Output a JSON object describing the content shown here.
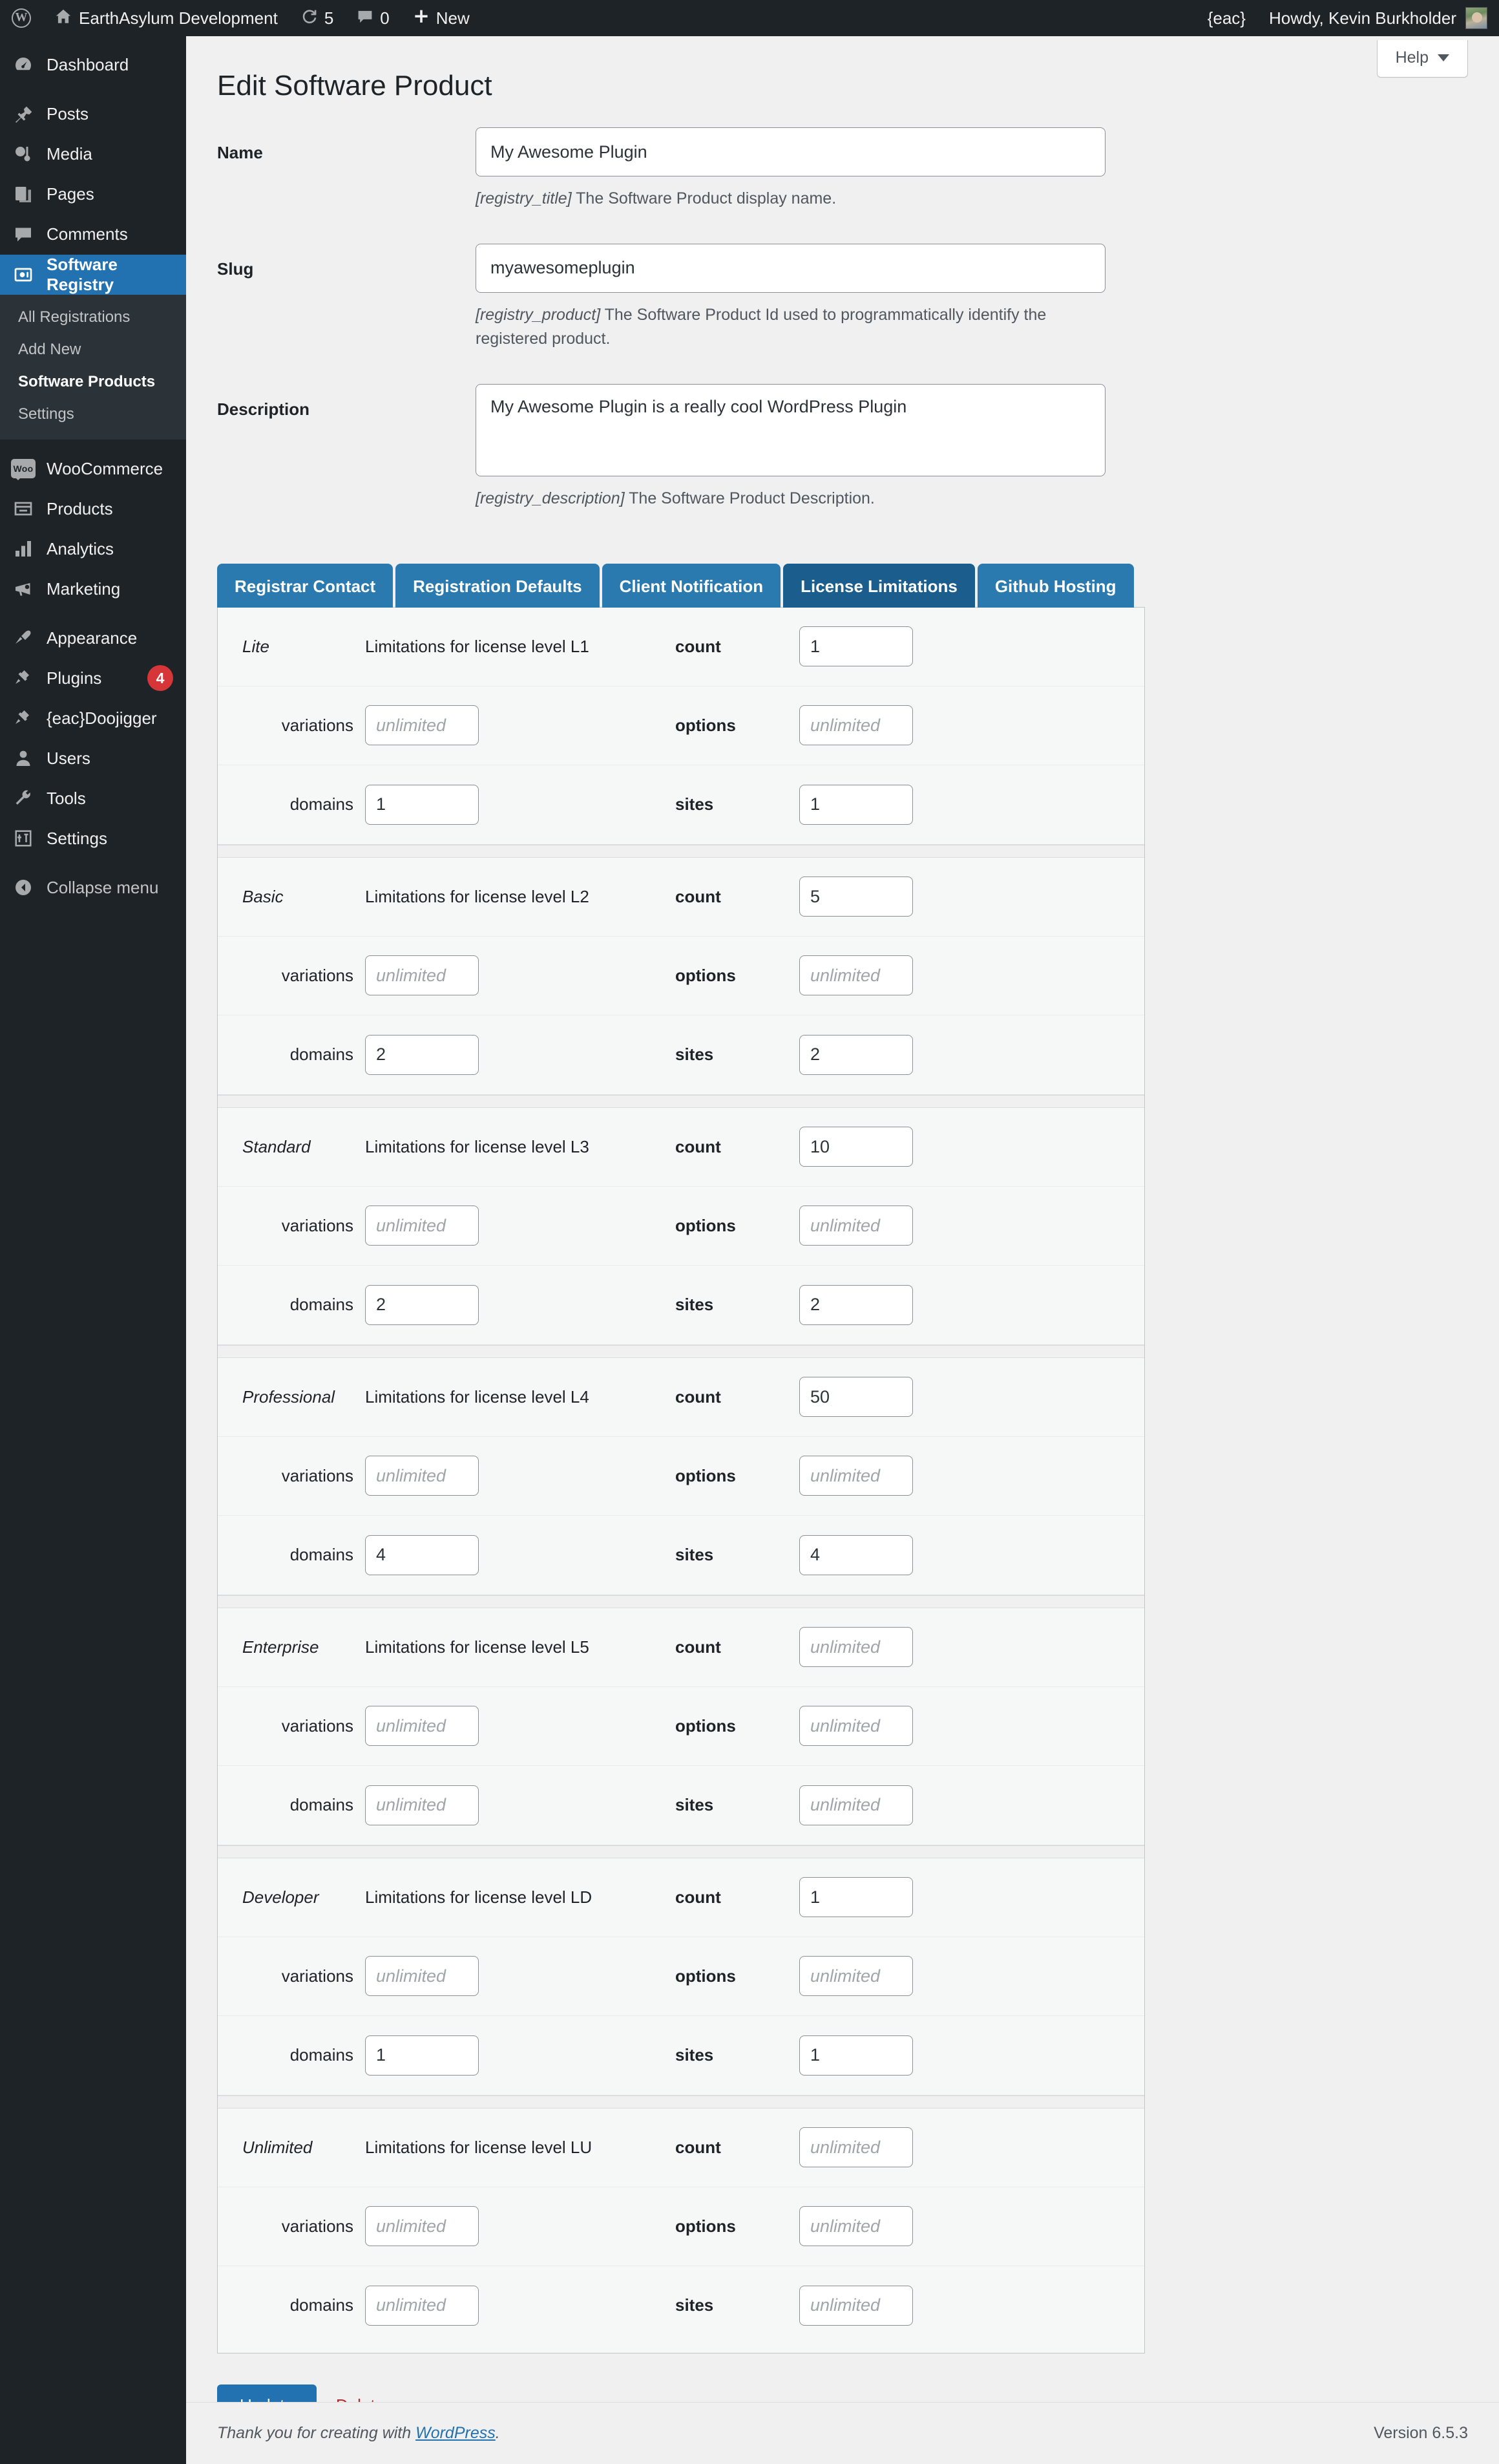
{
  "adminbar": {
    "logo_icon": "wordpress-logo-icon",
    "home_icon": "home-icon",
    "site_name": "EarthAsylum Development",
    "updates_icon": "updates-icon",
    "updates_count": "5",
    "comments_icon": "comment-bubble-icon",
    "comments_count": "0",
    "new_icon": "plus-icon",
    "new_label": "New",
    "eac_label": "{eac}",
    "howdy": "Howdy, Kevin Burkholder",
    "avatar": "user-avatar"
  },
  "sidebar": {
    "items": [
      {
        "label": "Dashboard",
        "icon": "dashboard-icon",
        "current": false
      },
      {
        "label": "Posts",
        "icon": "pin-icon",
        "current": false
      },
      {
        "label": "Media",
        "icon": "media-icon",
        "current": false
      },
      {
        "label": "Pages",
        "icon": "pages-icon",
        "current": false
      },
      {
        "label": "Comments",
        "icon": "comments-icon",
        "current": false
      },
      {
        "label": "Software Registry",
        "icon": "software-registry-icon",
        "current": true
      },
      {
        "label": "WooCommerce",
        "icon": "woocommerce-icon",
        "current": false
      },
      {
        "label": "Products",
        "icon": "products-icon",
        "current": false
      },
      {
        "label": "Analytics",
        "icon": "analytics-icon",
        "current": false
      },
      {
        "label": "Marketing",
        "icon": "marketing-megaphone-icon",
        "current": false
      },
      {
        "label": "Appearance",
        "icon": "paintbrush-icon",
        "current": false
      },
      {
        "label": "Plugins",
        "icon": "plug-icon",
        "current": false,
        "badge": "4"
      },
      {
        "label": "{eac}Doojigger",
        "icon": "plug-icon",
        "current": false
      },
      {
        "label": "Users",
        "icon": "user-icon",
        "current": false
      },
      {
        "label": "Tools",
        "icon": "wrench-icon",
        "current": false
      },
      {
        "label": "Settings",
        "icon": "settings-sliders-icon",
        "current": false
      },
      {
        "label": "Collapse menu",
        "icon": "collapse-arrow-icon",
        "current": false
      }
    ],
    "submenu": [
      {
        "label": "All Registrations",
        "current": false
      },
      {
        "label": "Add New",
        "current": false
      },
      {
        "label": "Software Products",
        "current": true
      },
      {
        "label": "Settings",
        "current": false
      }
    ]
  },
  "header": {
    "page_title": "Edit Software Product",
    "help_label": "Help",
    "help_caret_icon": "chevron-down-icon"
  },
  "form": {
    "fields": [
      {
        "label": "Name",
        "value": "My Awesome Plugin",
        "placeholder": "",
        "desc_key": "[registry_title]",
        "desc_text": " The Software Product display name.",
        "type": "text"
      },
      {
        "label": "Slug",
        "value": "myawesomeplugin",
        "placeholder": "",
        "desc_key": "[registry_product]",
        "desc_text": " The Software Product Id used to programmatically identify the registered product.",
        "type": "text"
      },
      {
        "label": "Description",
        "value": "My Awesome Plugin is a really cool WordPress Plugin",
        "placeholder": "",
        "desc_key": "[registry_description]",
        "desc_text": " The Software Product Description.",
        "type": "textarea"
      }
    ]
  },
  "tabs": [
    {
      "label": "Registrar Contact",
      "active": false
    },
    {
      "label": "Registration Defaults",
      "active": false
    },
    {
      "label": "Client Notification",
      "active": false
    },
    {
      "label": "License Limitations",
      "active": true
    },
    {
      "label": "Github Hosting",
      "active": false
    }
  ],
  "license_panel": {
    "labels": {
      "count": "count",
      "variations": "variations",
      "options": "options",
      "domains": "domains",
      "sites": "sites"
    },
    "placeholder_unlimited": "unlimited",
    "levels": [
      {
        "name": "Lite",
        "description": "Limitations for license level L1",
        "count": "1",
        "variations": "",
        "options": "",
        "domains": "1",
        "sites": "1"
      },
      {
        "name": "Basic",
        "description": "Limitations for license level L2",
        "count": "5",
        "variations": "",
        "options": "",
        "domains": "2",
        "sites": "2"
      },
      {
        "name": "Standard",
        "description": "Limitations for license level L3",
        "count": "10",
        "variations": "",
        "options": "",
        "domains": "2",
        "sites": "2"
      },
      {
        "name": "Professional",
        "description": "Limitations for license level L4",
        "count": "50",
        "variations": "",
        "options": "",
        "domains": "4",
        "sites": "4"
      },
      {
        "name": "Enterprise",
        "description": "Limitations for license level L5",
        "count": "",
        "variations": "",
        "options": "",
        "domains": "",
        "sites": ""
      },
      {
        "name": "Developer",
        "description": "Limitations for license level LD",
        "count": "1",
        "variations": "",
        "options": "",
        "domains": "1",
        "sites": "1"
      },
      {
        "name": "Unlimited",
        "description": "Limitations for license level LU",
        "count": "",
        "variations": "",
        "options": "",
        "domains": "",
        "sites": ""
      }
    ]
  },
  "actions": {
    "update_label": "Update",
    "delete_label": "Delete"
  },
  "footer": {
    "thanks_prefix": "Thank you for creating with ",
    "wordpress_link": "WordPress",
    "thanks_suffix": ".",
    "version": "Version 6.5.3"
  },
  "colors": {
    "accent": "#2271b1",
    "tab": "#2a7ab0",
    "tab_active": "#1b5e8e",
    "admin_dark": "#1d2327",
    "danger": "#b32d2e",
    "badge_red": "#d63638"
  }
}
